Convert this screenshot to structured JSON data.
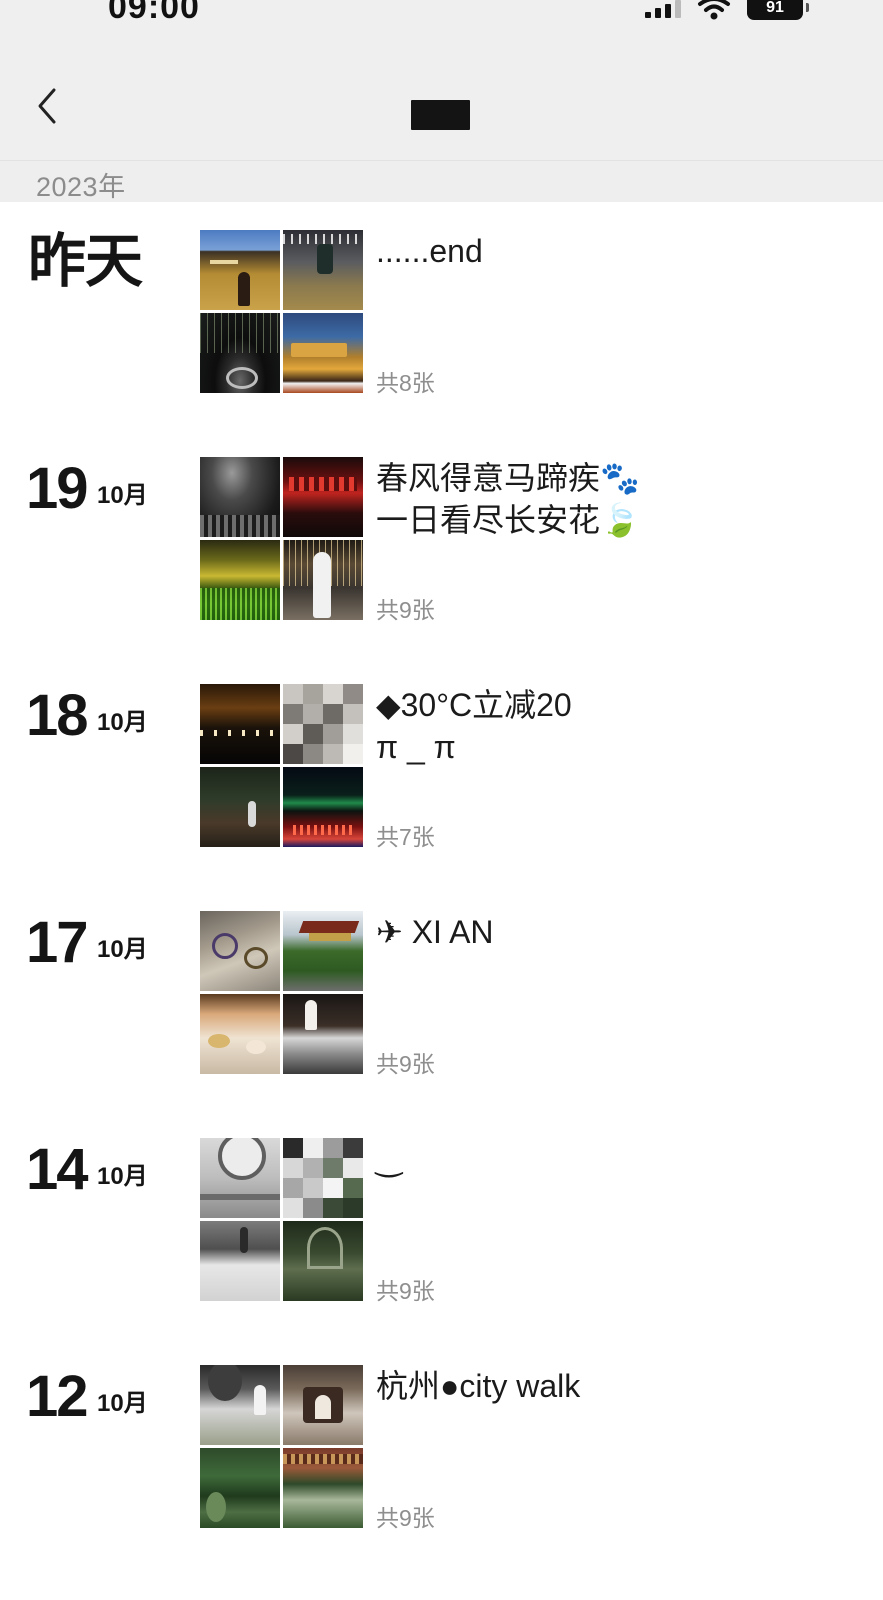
{
  "status_bar": {
    "time": "09:00",
    "battery": "91"
  },
  "nav": {
    "back_icon": "chevron-left-icon"
  },
  "year_header": "2023年",
  "posts": [
    {
      "date_label": "昨天",
      "day": "",
      "month": "",
      "caption": "......end",
      "count": "共8张"
    },
    {
      "date_label": "",
      "day": "19",
      "month": "10月",
      "caption": "春风得意马蹄疾🐾\n一日看尽长安花🍃",
      "count": "共9张"
    },
    {
      "date_label": "",
      "day": "18",
      "month": "10月",
      "caption": " ◆30°C立减20\n    π _ π",
      "count": "共7张"
    },
    {
      "date_label": "",
      "day": "17",
      "month": "10月",
      "caption": "✈ XI AN",
      "count": "共9张"
    },
    {
      "date_label": "",
      "day": "14",
      "month": "10月",
      "caption": " ‿",
      "count": "共9张"
    },
    {
      "date_label": "",
      "day": "12",
      "month": "10月",
      "caption": "杭州●city walk",
      "count": "共9张"
    }
  ]
}
